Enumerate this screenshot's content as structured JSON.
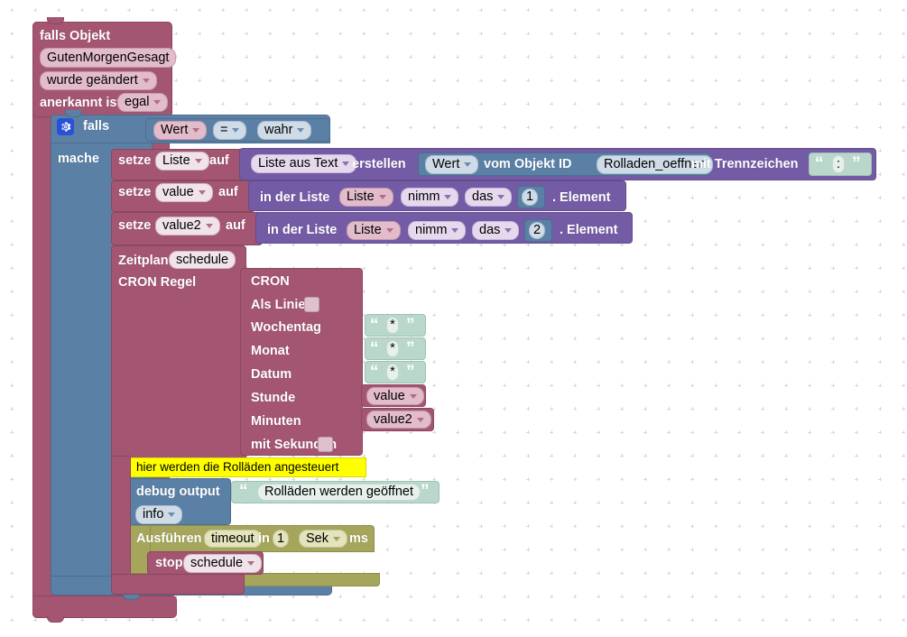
{
  "workspace": {
    "type": "blockly-visual-programming-canvas",
    "language": "de",
    "colors": {
      "event_rose": "#a35571",
      "control_blue": "#5b80a5",
      "list_purple": "#745ba5",
      "timer_olive": "#a5a55b",
      "text_mint": "#b9d7cb",
      "comment_yellow": "#ffff00"
    }
  },
  "event_block": {
    "title": "falls Objekt",
    "object_id": "GutenMorgenGesagt",
    "trigger": "wurde geändert",
    "ack_label": "anerkannt ist",
    "ack_value": "egal"
  },
  "if_block": {
    "gear_icon": "mutator-gear-icon",
    "if_label": "falls",
    "do_label": "mache",
    "condition": {
      "left": "Wert",
      "operator": "=",
      "right": "wahr"
    }
  },
  "set_list": {
    "set_label": "setze",
    "variable": "Liste",
    "to_label": "auf",
    "value": {
      "list_from_text": "Liste aus Text",
      "create_label": "erstellen",
      "get_state": "Wert",
      "of_object_label": "vom Objekt ID",
      "object_id": "Rolladen_oeffnen",
      "separator_label": "mit Trennzeichen",
      "separator_value": ":"
    }
  },
  "set_value": {
    "set_label": "setze",
    "variable": "value",
    "to_label": "auf",
    "in_list_label": "in der Liste",
    "list_var": "Liste",
    "take_label": "nimm",
    "which_label": "das",
    "index": "1",
    "element_label": "Element"
  },
  "set_value2": {
    "set_label": "setze",
    "variable": "value2",
    "to_label": "auf",
    "in_list_label": "in der Liste",
    "list_var": "Liste",
    "take_label": "nimm",
    "which_label": "das",
    "index": "2",
    "element_label": "Element"
  },
  "schedule_block": {
    "schedule_label": "Zeitplan",
    "schedule_name": "schedule",
    "cron_rule_label": "CRON Regel"
  },
  "cron_block": {
    "title": "CRON",
    "as_line_label": "Als Linie",
    "as_line_checked": false,
    "rows": [
      {
        "label": "Wochentag",
        "value": "*",
        "kind": "text"
      },
      {
        "label": "Monat",
        "value": "*",
        "kind": "text"
      },
      {
        "label": "Datum",
        "value": "*",
        "kind": "text"
      },
      {
        "label": "Stunde",
        "value": "value",
        "kind": "variable"
      },
      {
        "label": "Minuten",
        "value": "value2",
        "kind": "variable"
      }
    ],
    "with_seconds_label": "mit Sekunden",
    "with_seconds_checked": false
  },
  "comment": {
    "text": "hier werden die Rolläden angesteuert"
  },
  "debug_block": {
    "label": "debug output",
    "message": "Rolläden werden geöffnet",
    "level": "info"
  },
  "timeout_block": {
    "run_label": "Ausführen",
    "name": "timeout",
    "in_label": "in",
    "delay": "1",
    "unit": "Sek",
    "unit_suffix": "ms",
    "inner": {
      "stop_label": "stop",
      "target": "schedule"
    }
  }
}
